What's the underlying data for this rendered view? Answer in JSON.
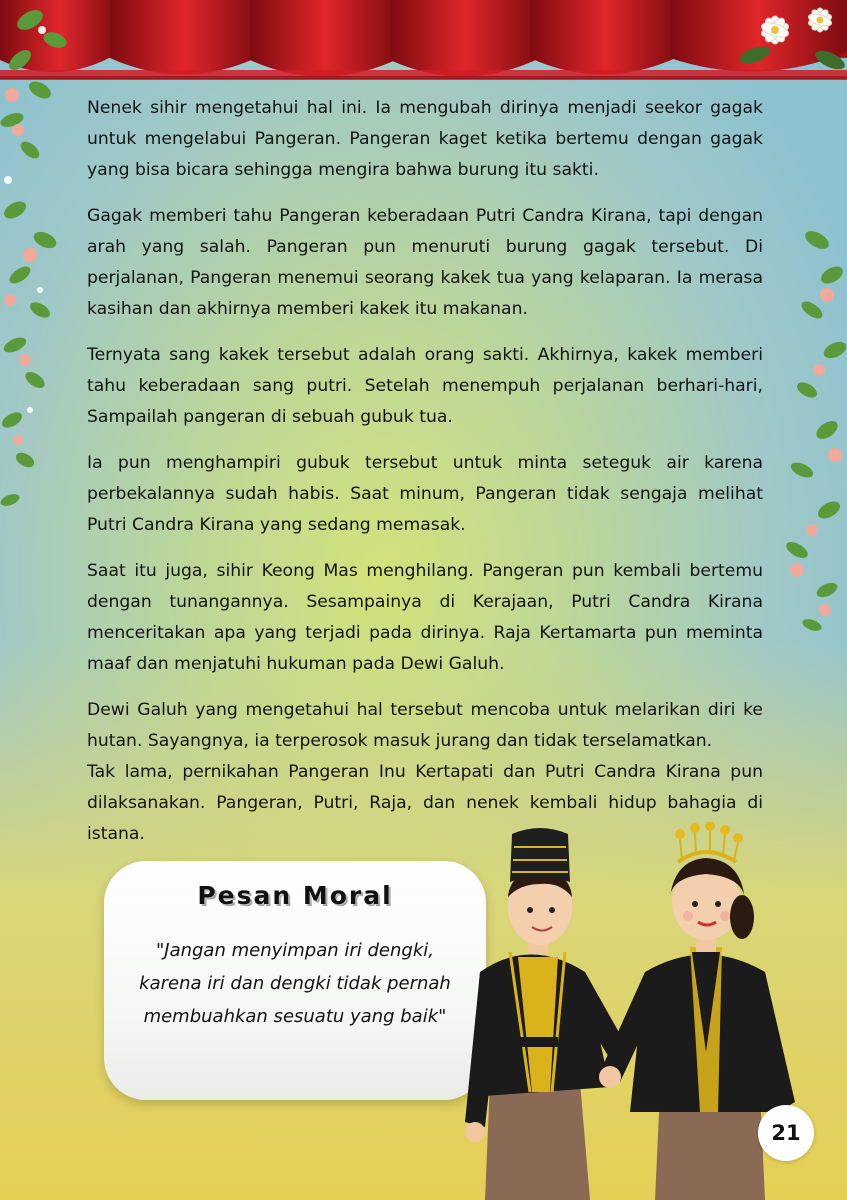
{
  "story": {
    "p1": "Nenek sihir mengetahui hal ini. Ia mengubah dirinya menjadi seekor gagak untuk mengelabui Pangeran. Pangeran kaget ketika bertemu dengan gagak yang bisa bicara sehingga mengira bahwa burung itu sakti.",
    "p2": "Gagak memberi tahu Pangeran keberadaan Putri Candra Kirana, tapi dengan arah yang salah. Pangeran pun menuruti burung gagak tersebut. Di perjalanan, Pangeran menemui seorang kakek tua yang kelaparan. Ia merasa kasihan dan akhirnya memberi kakek itu makanan.",
    "p3": "Ternyata sang kakek tersebut adalah orang sakti. Akhirnya, kakek memberi tahu keberadaan sang putri. Setelah menempuh perjalanan berhari-hari, Sampailah pangeran di sebuah gubuk tua.",
    "p4": "Ia pun menghampiri gubuk tersebut untuk minta seteguk air karena perbekalannya sudah habis. Saat minum, Pangeran tidak sengaja melihat Putri Candra Kirana yang sedang memasak.",
    "p5": "Saat itu juga, sihir Keong Mas menghilang. Pangeran pun kembali bertemu dengan tunangannya. Sesampainya di Kerajaan, Putri Candra Kirana menceritakan apa yang terjadi pada dirinya. Raja Kertamarta pun meminta maaf dan menjatuhi hukuman pada Dewi Galuh.",
    "p6": "Dewi Galuh yang mengetahui hal tersebut mencoba untuk melarikan diri ke hutan. Sayangnya, ia terperosok masuk jurang dan tidak terselamatkan.",
    "p7": "Tak lama, pernikahan Pangeran Inu Kertapati dan Putri Candra Kirana pun dilaksanakan. Pangeran, Putri, Raja, dan nenek kembali hidup bahagia di istana."
  },
  "moral": {
    "title": "Pesan Moral",
    "quote_line1": "\"Jangan menyimpan iri dengki,",
    "quote_line2": "karena iri dan dengki tidak pernah",
    "quote_line3": "membuahkan sesuatu yang baik\""
  },
  "page_number": "21",
  "colors": {
    "curtain": "#c0141c",
    "card": "#f4f6f4",
    "costume_black": "#1b1b1b",
    "costume_gold": "#d9b21c"
  },
  "icons": [
    "red-curtain-icon",
    "flower-vine-icon",
    "jasmine-flower-icon",
    "couple-illustration-icon"
  ]
}
